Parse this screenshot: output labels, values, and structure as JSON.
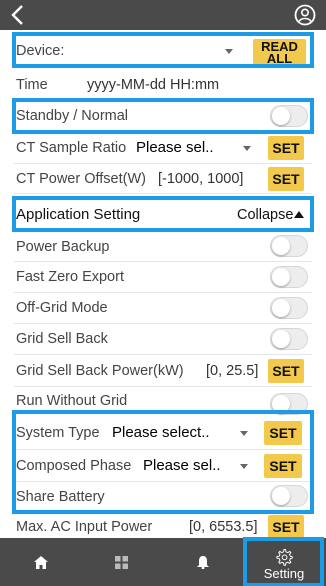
{
  "header": {
    "back_icon": "chevron-left-icon",
    "user_icon": "user-circle-icon"
  },
  "device": {
    "label": "Device:",
    "value": "",
    "button": "READ ALL"
  },
  "time": {
    "label": "Time",
    "value": "yyyy-MM-dd  HH:mm"
  },
  "standby": {
    "label": "Standby / Normal",
    "on": false
  },
  "ct_sample_ratio": {
    "label": "CT Sample Ratio",
    "value": "Please sel..",
    "button": "SET"
  },
  "ct_power_offset": {
    "label": "CT Power Offset(W)",
    "range": "[-1000, 1000]",
    "button": "SET"
  },
  "application_setting": {
    "label": "Application Setting",
    "toggle_label": "Collapse"
  },
  "power_backup": {
    "label": "Power Backup",
    "on": false
  },
  "fast_zero_export": {
    "label": "Fast Zero Export",
    "on": false
  },
  "off_grid_mode": {
    "label": "Off-Grid Mode",
    "on": false
  },
  "grid_sell_back": {
    "label": "Grid Sell Back",
    "on": false
  },
  "grid_sell_back_power": {
    "label": "Grid Sell Back Power(kW)",
    "range": "[0, 25.5]",
    "button": "SET"
  },
  "run_without_grid": {
    "label": "Run Without Grid",
    "on": false
  },
  "system_type": {
    "label": "System Type",
    "value": "Please select..",
    "button": "SET"
  },
  "composed_phase": {
    "label": "Composed Phase",
    "value": "Please sel..",
    "button": "SET"
  },
  "share_battery": {
    "label": "Share Battery",
    "on": false
  },
  "max_ac_input_power": {
    "label": "Max. AC Input Power",
    "range": "[0, 6553.5]",
    "button": "SET"
  },
  "bottom_nav": {
    "tabs": [
      {
        "icon": "home-icon",
        "label": ""
      },
      {
        "icon": "grid-icon",
        "label": ""
      },
      {
        "icon": "bell-icon",
        "label": ""
      },
      {
        "icon": "gear-icon",
        "label": "Setting",
        "active": true
      }
    ]
  },
  "colors": {
    "accent": "#f2c94c",
    "highlight": "#1d9be6",
    "bar": "#4a4a4a"
  }
}
